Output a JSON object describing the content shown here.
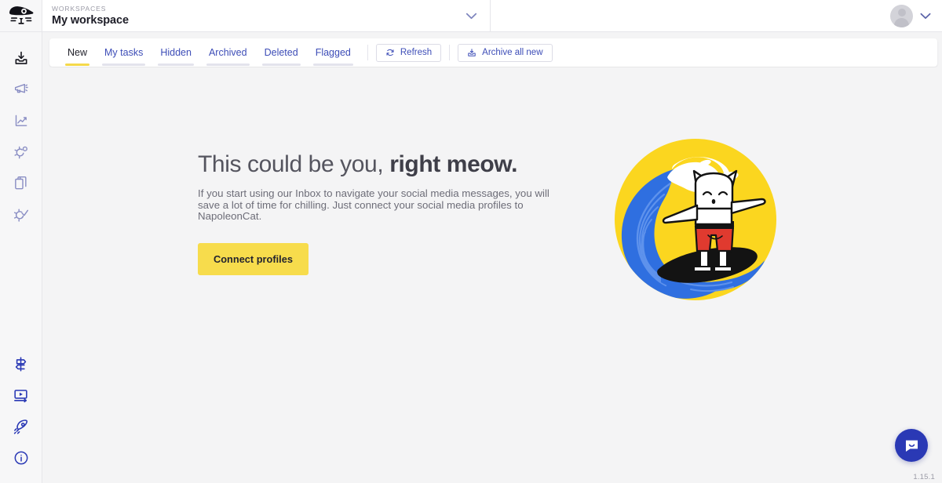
{
  "app": {
    "logo_icon": "napoleoncat-cat-logo",
    "version": "1.15.1"
  },
  "topbar": {
    "workspace_label": "WORKSPACES",
    "workspace_name": "My workspace",
    "workspace_chevron_icon": "chevron-down-icon",
    "avatar_icon": "user-avatar-placeholder",
    "user_chevron_icon": "chevron-down-icon"
  },
  "sidebar": {
    "top_items": [
      {
        "name": "inbox",
        "icon": "inbox-tray-icon",
        "active": true
      },
      {
        "name": "publisher",
        "icon": "megaphone-icon",
        "active": false
      },
      {
        "name": "analytics",
        "icon": "line-chart-icon",
        "active": false
      },
      {
        "name": "automation",
        "icon": "gear-automation-icon",
        "active": false
      },
      {
        "name": "content",
        "icon": "copy-pages-icon",
        "active": false
      },
      {
        "name": "moderation",
        "icon": "gear-check-icon",
        "active": false
      }
    ],
    "bottom_items": [
      {
        "name": "getting-started",
        "icon": "signpost-icon"
      },
      {
        "name": "tutorials",
        "icon": "video-player-icon"
      },
      {
        "name": "whats-new",
        "icon": "rocket-icon"
      },
      {
        "name": "help",
        "icon": "info-circle-icon"
      }
    ]
  },
  "tabbar": {
    "tabs": [
      {
        "label": "New",
        "active": true
      },
      {
        "label": "My tasks",
        "active": false
      },
      {
        "label": "Hidden",
        "active": false
      },
      {
        "label": "Archived",
        "active": false
      },
      {
        "label": "Deleted",
        "active": false
      },
      {
        "label": "Flagged",
        "active": false
      }
    ],
    "refresh_label": "Refresh",
    "refresh_icon": "refresh-circular-arrow-icon",
    "archive_label": "Archive all new",
    "archive_icon": "archive-tray-icon"
  },
  "empty_state": {
    "title_light": "This could be you,",
    "title_bold": "right meow.",
    "body": "If you start using our Inbox to navigate your social media messages, you will save a lot of time for chilling. Just connect your social media profiles to NapoleonCat.",
    "cta_label": "Connect profiles",
    "illustration_icon": "surfing-cat-illustration"
  },
  "intercom": {
    "icon": "chat-bubble-smile-icon"
  },
  "colors": {
    "brand_yellow": "#f7dc4c",
    "brand_navy": "#2a39b5",
    "link_blue": "#3d4db7",
    "page_bg": "#f4f4f5",
    "wave_blue": "#2f6fe0",
    "shorts_red": "#e03a2f"
  }
}
